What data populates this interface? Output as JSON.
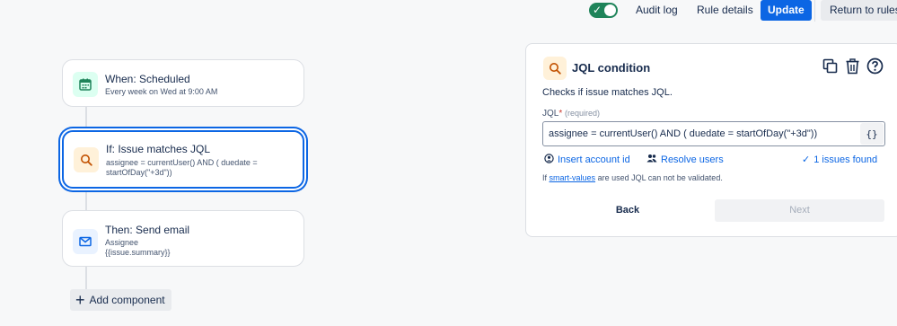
{
  "topbar": {
    "toggle_state": "on",
    "audit_log": "Audit log",
    "rule_details": "Rule details",
    "update": "Update",
    "return_to_rules": "Return to rules"
  },
  "flow": {
    "trigger": {
      "title": "When: Scheduled",
      "subtitle": "Every week on Wed at 9:00 AM",
      "icon": "calendar-icon"
    },
    "condition": {
      "title": "If: Issue matches JQL",
      "subtitle": "assignee = currentUser() AND ( duedate = startOfDay(\"+3d\"))",
      "icon": "search-icon"
    },
    "action": {
      "title": "Then: Send email",
      "subtitle_line1": "Assignee",
      "subtitle_line2": "{{issue.summary}}",
      "icon": "mail-icon"
    },
    "add_component": "Add component"
  },
  "panel": {
    "title": "JQL condition",
    "description": "Checks if issue matches JQL.",
    "jql_label": "JQL",
    "required_marker": "*",
    "required_text": "(required)",
    "jql_value": "assignee = currentUser() AND ( duedate = startOfDay(\"+3d\"))",
    "smart_values_button": "{}",
    "insert_account_id": "Insert account id",
    "resolve_users": "Resolve users",
    "issues_found": "1 issues found",
    "note_prefix": "If",
    "note_link": "smart-values",
    "note_suffix": "are used JQL can not be validated.",
    "back": "Back",
    "next": "Next"
  },
  "colors": {
    "primary": "#0c66e4",
    "toggle_on": "#1f845a",
    "trigger_icon_bg": "#dcfff1",
    "condition_icon_bg": "#fff1d9",
    "action_icon_bg": "#e9f2ff"
  }
}
